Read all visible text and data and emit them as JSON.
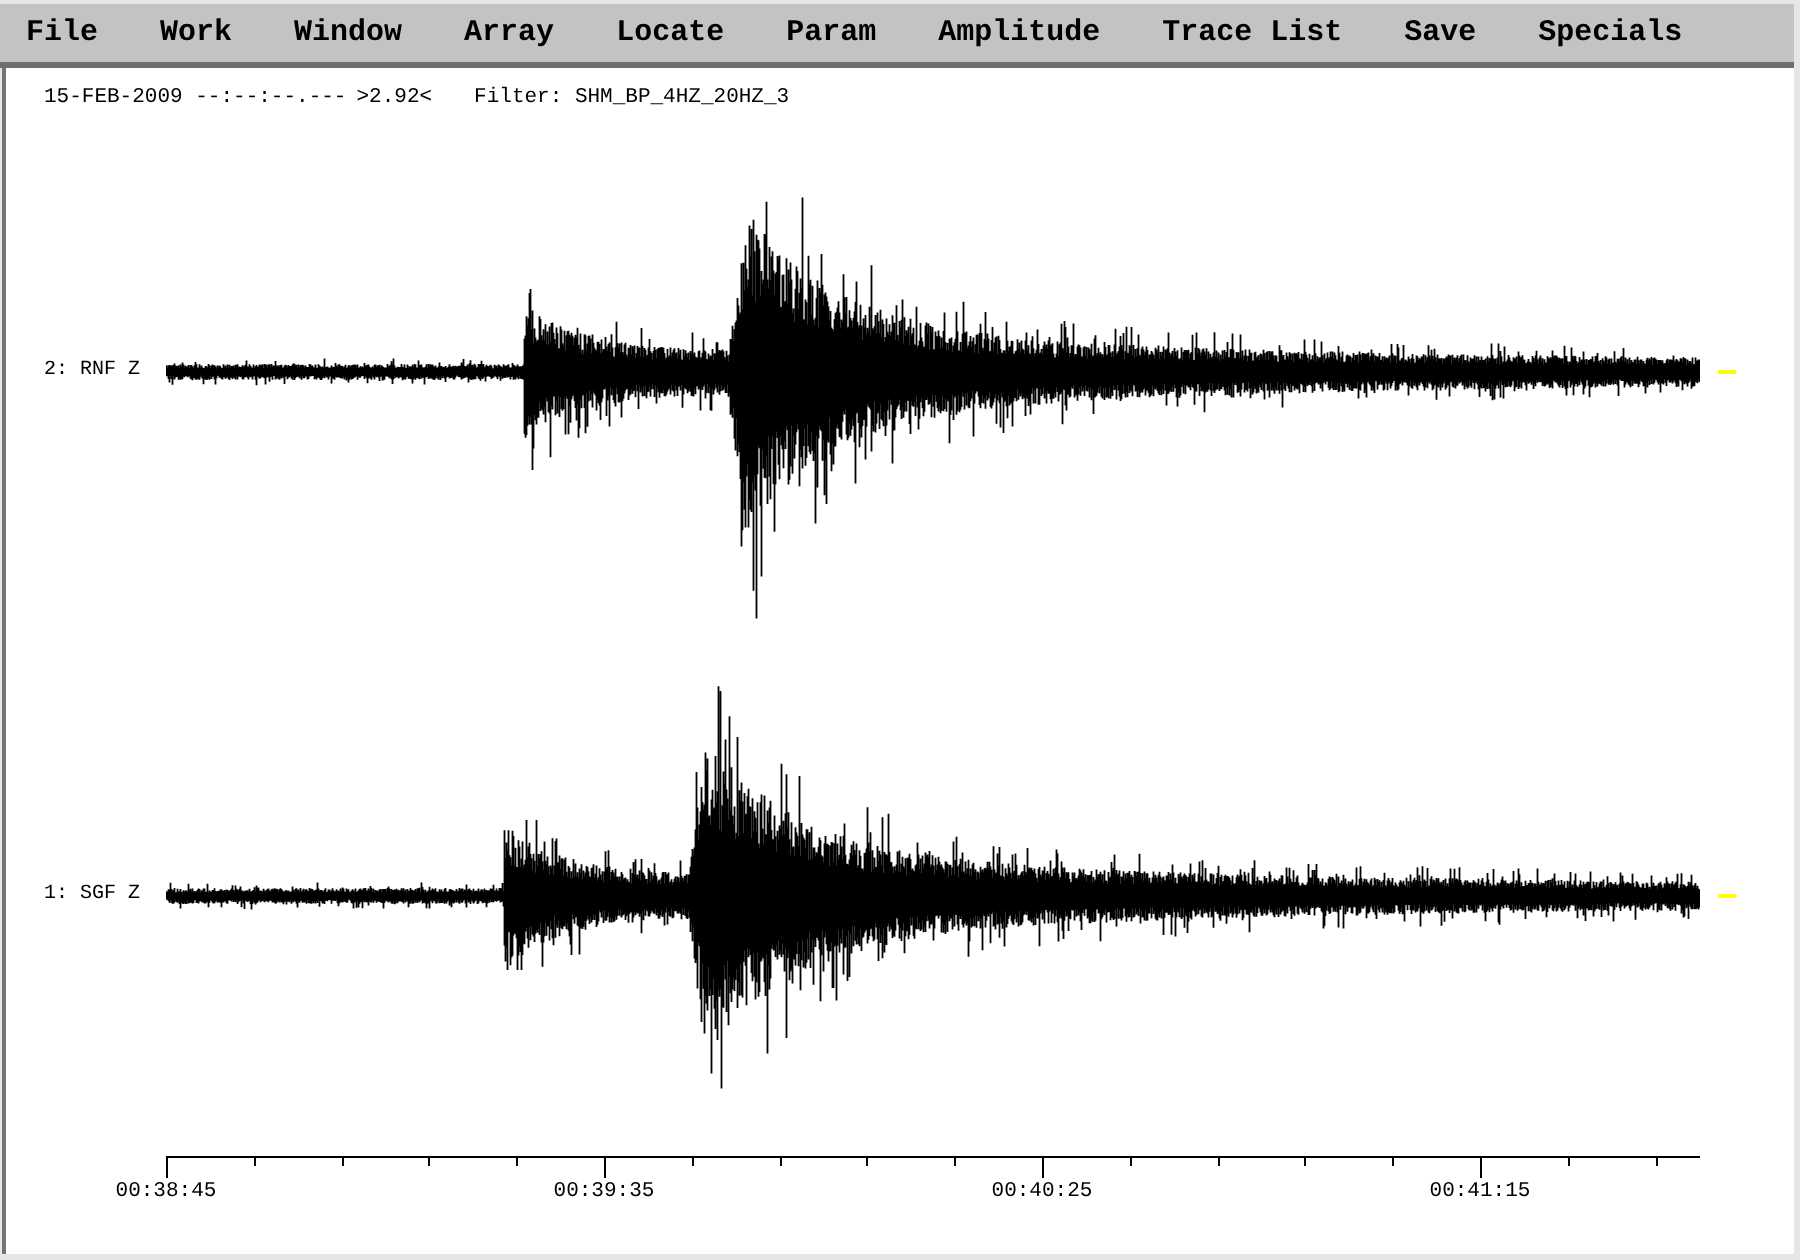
{
  "menu_bar": {
    "items": [
      "File",
      "Work",
      "Window",
      "Array",
      "Locate",
      "Param",
      "Amplitude",
      "Trace List",
      "Save",
      "Specials"
    ]
  },
  "header": {
    "date_time": "15-FEB-2009 --:--:--.---",
    "scale": ">2.92<",
    "filter": "Filter: SHM_BP_4HZ_20HZ_3"
  },
  "traces": [
    {
      "label": "2: RNF Z"
    },
    {
      "label": "1: SGF Z"
    }
  ],
  "time_axis": {
    "labels": [
      "00:38:45",
      "00:39:35",
      "00:40:25",
      "00:41:15"
    ]
  }
}
